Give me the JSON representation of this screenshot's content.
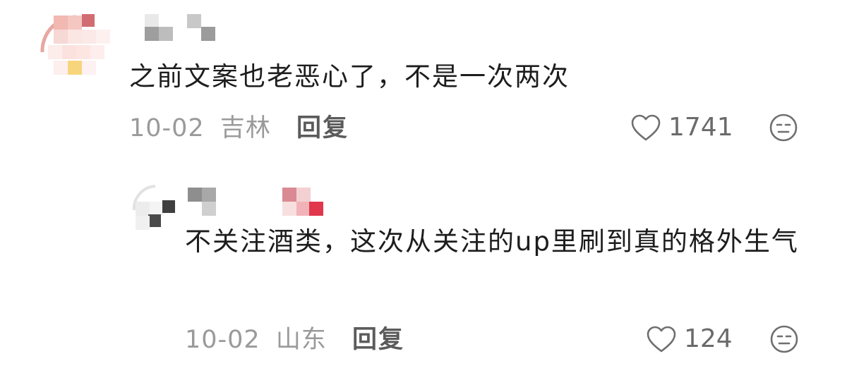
{
  "comments": [
    {
      "text": "之前文案也老恶心了，不是一次两次",
      "date": "10-02",
      "location": "吉林",
      "reply_label": "回复",
      "like_count": "1741",
      "like_icon": "heart-outline-icon",
      "dislike_icon": "meh-face-icon"
    },
    {
      "text": "不关注酒类，这次从关注的up里刷到真的格外生气",
      "date": "10-02",
      "location": "山东",
      "reply_label": "回复",
      "like_count": "124",
      "like_icon": "heart-outline-icon",
      "dislike_icon": "meh-face-icon"
    }
  ]
}
